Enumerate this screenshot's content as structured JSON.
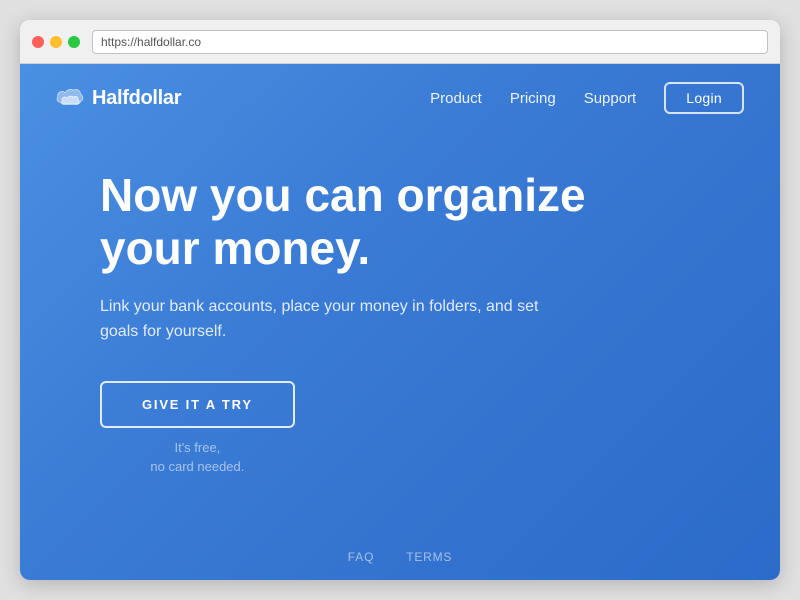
{
  "browser": {
    "url": "https://halfdollar.co"
  },
  "navbar": {
    "logo_text": "Halfdollar",
    "links": [
      {
        "label": "Product"
      },
      {
        "label": "Pricing"
      },
      {
        "label": "Support"
      }
    ],
    "login_label": "Login"
  },
  "hero": {
    "headline": "Now you can organize your money.",
    "subtext": "Link your bank accounts, place your money in folders, and set goals for yourself.",
    "cta_label": "GIVE IT A TRY",
    "cta_sub_line1": "It's free,",
    "cta_sub_line2": "no card needed."
  },
  "footer": {
    "links": [
      {
        "label": "FAQ"
      },
      {
        "label": "TERMS"
      }
    ]
  }
}
